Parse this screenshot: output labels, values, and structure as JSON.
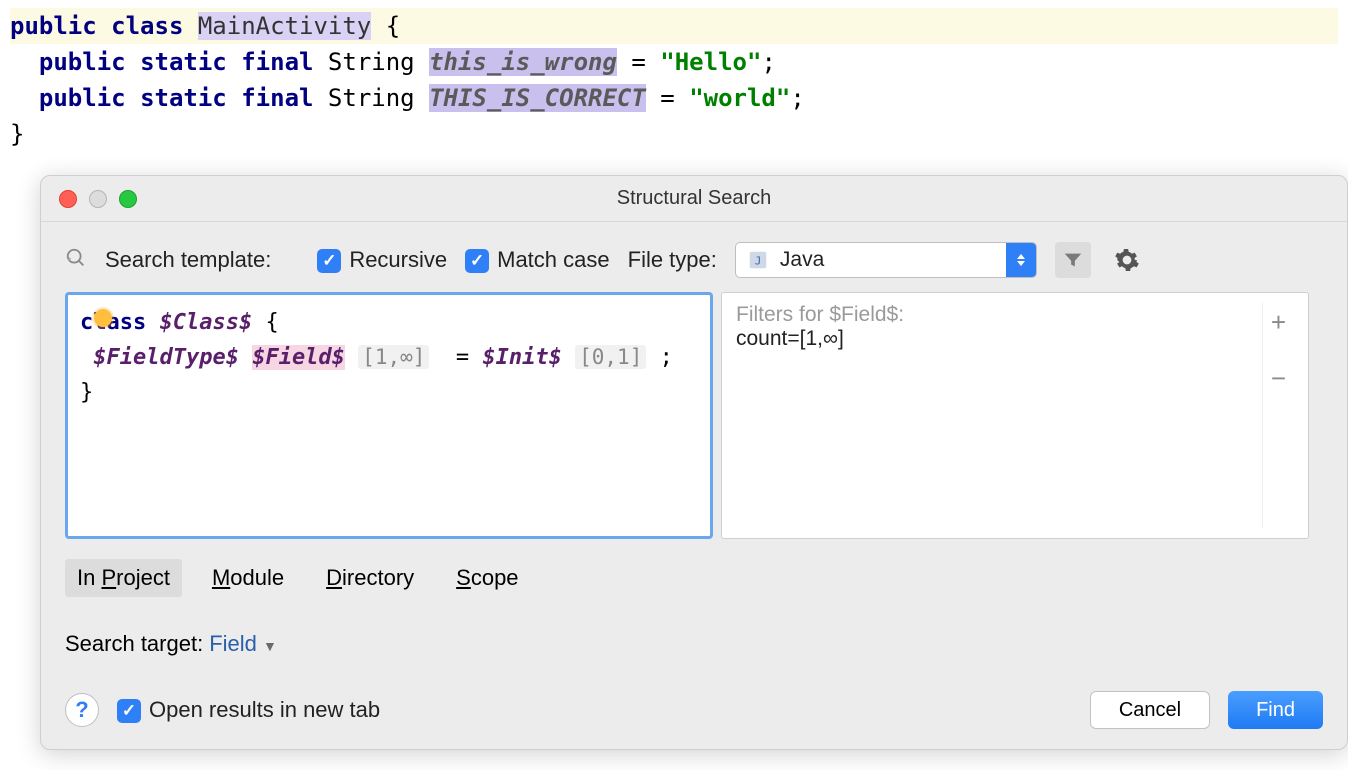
{
  "code": {
    "kw_public": "public",
    "kw_class": "class",
    "class_name": "MainActivity",
    "brace_open": "{",
    "kw_static": "static",
    "kw_final": "final",
    "type_string": "String",
    "field1": "this_is_wrong",
    "eq": "=",
    "val1": "\"Hello\"",
    "semi": ";",
    "field2": "THIS_IS_CORRECT",
    "val2": "\"world\"",
    "brace_close": "}"
  },
  "dialog": {
    "title": "Structural Search",
    "search_template_label": "Search template:",
    "recursive_label": "Recursive",
    "match_case_label": "Match case",
    "file_type_label": "File type:",
    "file_type_value": "Java",
    "recursive_checked": true,
    "match_case_checked": true
  },
  "template": {
    "kw_class": "class",
    "var_class": "$Class$",
    "brace_open": "{",
    "var_fieldtype": "$FieldType$",
    "var_field": "$Field$",
    "field_count": "[1,∞]",
    "eq": "=",
    "var_init": "$Init$",
    "init_count": "[0,1]",
    "semi": ";",
    "brace_close": "}"
  },
  "filters": {
    "title": "Filters for $Field$:",
    "count_line": "count=[1,∞]"
  },
  "scope": {
    "p_prefix": "In ",
    "p_ul": "P",
    "p_suffix": "roject",
    "m_ul": "M",
    "m_suffix": "odule",
    "d_ul": "D",
    "d_suffix": "irectory",
    "s_ul": "S",
    "s_suffix": "cope"
  },
  "search_target": {
    "label": "Search target:",
    "value": "Field"
  },
  "bottom": {
    "open_results_label": "Open results in new tab",
    "cancel": "Cancel",
    "find": "Find",
    "help": "?"
  }
}
